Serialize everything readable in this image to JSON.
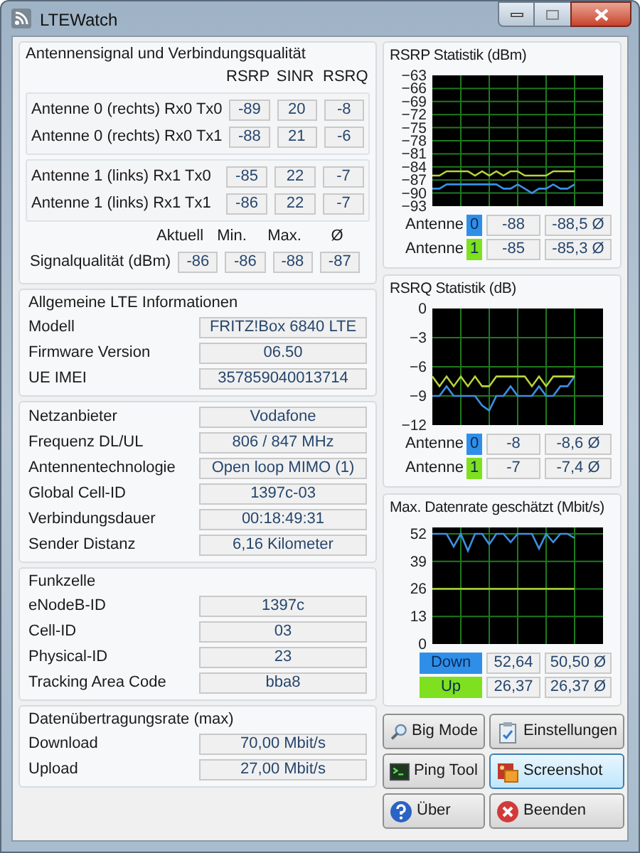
{
  "window": {
    "title": "LTEWatch"
  },
  "antenna_signal": {
    "title": "Antennensignal und Verbindungsqualität",
    "columns": [
      "RSRP",
      "SINR",
      "RSRQ"
    ],
    "groups": [
      [
        {
          "label": "Antenne 0 (rechts) Rx0 Tx0",
          "values": [
            "-89",
            "20",
            "-8"
          ]
        },
        {
          "label": "Antenne 0 (rechts) Rx0 Tx1",
          "values": [
            "-88",
            "21",
            "-6"
          ]
        }
      ],
      [
        {
          "label": "Antenne 1 (links) Rx1 Tx0",
          "values": [
            "-85",
            "22",
            "-7"
          ]
        },
        {
          "label": "Antenne 1 (links) Rx1 Tx1",
          "values": [
            "-86",
            "22",
            "-7"
          ]
        }
      ]
    ],
    "quality": {
      "columns": [
        "Aktuell",
        "Min.",
        "Max.",
        "Ø"
      ],
      "label": "Signalqualität (dBm)",
      "values": [
        "-86",
        "-86",
        "-88",
        "-87"
      ]
    }
  },
  "sections": [
    {
      "title": "Allgemeine LTE Informationen",
      "rows": [
        {
          "label": "Modell",
          "value": "FRITZ!Box 6840 LTE"
        },
        {
          "label": "Firmware Version",
          "value": "06.50"
        },
        {
          "label": "UE IMEI",
          "value": "357859040013714"
        }
      ]
    },
    {
      "rows": [
        {
          "label": "Netzanbieter",
          "value": "Vodafone"
        },
        {
          "label": "Frequenz DL/UL",
          "value": "806 / 847 MHz"
        },
        {
          "label": "Antennentechnologie",
          "value": "Open loop MIMO (1)"
        },
        {
          "label": "Global Cell-ID",
          "value": "1397c-03"
        },
        {
          "label": "Verbindungsdauer",
          "value": "00:18:49:31"
        },
        {
          "label": "Sender Distanz",
          "value": "6,16 Kilometer"
        }
      ]
    },
    {
      "title": "Funkzelle",
      "rows": [
        {
          "label": "eNodeB-ID",
          "value": "1397c"
        },
        {
          "label": "Cell-ID",
          "value": "03"
        },
        {
          "label": "Physical-ID",
          "value": "23"
        },
        {
          "label": "Tracking Area Code",
          "value": "bba8"
        }
      ]
    },
    {
      "title": "Datenübertragungsrate (max)",
      "rows": [
        {
          "label": "Download",
          "value": "70,00 Mbit/s"
        },
        {
          "label": "Upload",
          "value": "27,00 Mbit/s"
        }
      ]
    }
  ],
  "charts": [
    {
      "title": "RSRP Statistik (dBm)",
      "chart_data": {
        "type": "line",
        "grid": true,
        "ylim": [
          -93,
          -63
        ],
        "yticks": [
          -63,
          -66,
          -69,
          -72,
          -75,
          -78,
          -81,
          -84,
          -87,
          -90,
          -93
        ],
        "series": [
          {
            "color": "#3d8fe0",
            "values": [
              -89,
              -89,
              -88,
              -88,
              -88,
              -88,
              -88,
              -88,
              -88,
              -88,
              -89,
              -89,
              -88,
              -89,
              -90,
              -89,
              -89,
              -88,
              -89,
              -89,
              -88
            ]
          },
          {
            "color": "#b8d43a",
            "values": [
              -86,
              -86,
              -85,
              -85,
              -85,
              -85,
              -86,
              -85,
              -86,
              -85,
              -86,
              -85,
              -85,
              -86,
              -86,
              -86,
              -86,
              -85,
              -85,
              -85,
              -85
            ]
          }
        ]
      },
      "legend": [
        {
          "label": "Antenne",
          "badge": "0",
          "color": "#2f8fe8",
          "current": "-88",
          "average": "-88,5 Ø"
        },
        {
          "label": "Antenne",
          "badge": "1",
          "color": "#7ee01e",
          "current": "-85",
          "average": "-85,3 Ø"
        }
      ]
    },
    {
      "title": "RSRQ Statistik (dB)",
      "chart_data": {
        "type": "line",
        "grid": true,
        "ylim": [
          -12,
          0
        ],
        "yticks": [
          0,
          -3,
          -6,
          -9,
          -12
        ],
        "series": [
          {
            "color": "#3d8fe0",
            "values": [
              -9,
              -9,
              -8,
              -9,
              -9,
              -9,
              -9,
              -10,
              -10.5,
              -9,
              -9,
              -8,
              -9,
              -9,
              -9,
              -8,
              -9,
              -9,
              -8,
              -8,
              -7
            ]
          },
          {
            "color": "#b8d43a",
            "values": [
              -7,
              -8,
              -7,
              -8,
              -7,
              -8,
              -7,
              -8,
              -8,
              -7,
              -7,
              -7,
              -7,
              -7,
              -8,
              -7,
              -8,
              -7,
              -7,
              -7,
              -7
            ]
          }
        ]
      },
      "legend": [
        {
          "label": "Antenne",
          "badge": "0",
          "color": "#2f8fe8",
          "current": "-8",
          "average": "-8,6 Ø"
        },
        {
          "label": "Antenne",
          "badge": "1",
          "color": "#7ee01e",
          "current": "-7",
          "average": "-7,4 Ø"
        }
      ]
    },
    {
      "title": "Max. Datenrate geschätzt (Mbit/s)",
      "chart_data": {
        "type": "line",
        "grid": true,
        "ylim": [
          0,
          55
        ],
        "yticks": [
          0,
          13,
          26,
          39,
          52
        ],
        "series": [
          {
            "color": "#3d8fe0",
            "values": [
              52,
              52,
              52,
              46,
              52,
              44,
              52,
              52,
              47,
              52,
              52,
              48,
              52,
              52,
              52,
              45,
              52,
              48,
              52,
              52,
              50
            ]
          },
          {
            "color": "#9cc830",
            "values": [
              26,
              26,
              26,
              26,
              26,
              26,
              26,
              26,
              26,
              26,
              26,
              26,
              26,
              26,
              26,
              26,
              26,
              26,
              26,
              26,
              26
            ]
          }
        ]
      },
      "legend": [
        {
          "badge": "Down",
          "color": "#2f8fe8",
          "current": "52,64",
          "average": "50,50 Ø"
        },
        {
          "badge": "Up",
          "color": "#7ee01e",
          "current": "26,37",
          "average": "26,37 Ø"
        }
      ]
    }
  ],
  "buttons": [
    {
      "label": "Big Mode",
      "hovered": false
    },
    {
      "label": "Einstellungen",
      "hovered": false
    },
    {
      "label": "Ping Tool",
      "hovered": false
    },
    {
      "label": "Screenshot",
      "hovered": true
    },
    {
      "label": "Über",
      "hovered": false
    },
    {
      "label": "Beenden",
      "hovered": false
    }
  ]
}
